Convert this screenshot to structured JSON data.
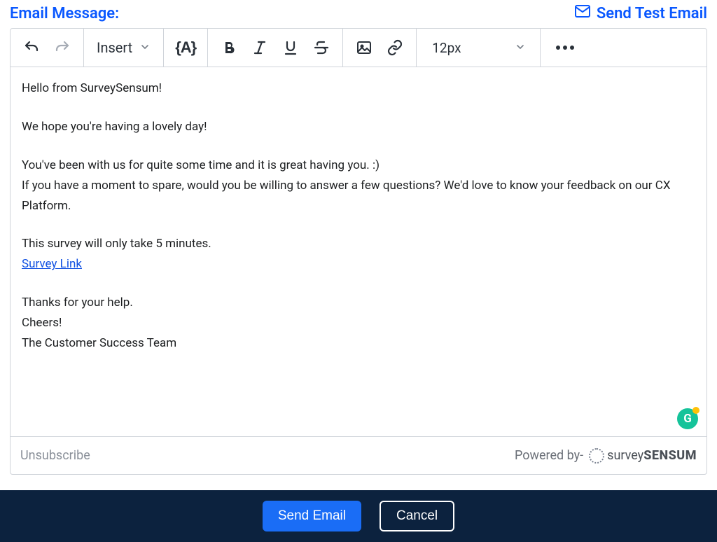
{
  "header": {
    "title": "Email Message:",
    "send_test": "Send Test Email"
  },
  "toolbar": {
    "insert_label": "Insert",
    "vars_label": "{A}",
    "fontsize": "12px"
  },
  "body": {
    "p1": "Hello from SurveySensum!",
    "p2": "We hope you're having a lovely day!",
    "p3": "You've been with us for quite some time and it is great having you. :)",
    "p4": "If you have a moment to spare, would you be willing to answer a few questions? We'd love to know your feedback on our CX Platform.",
    "p5": "This survey will only take 5 minutes.",
    "link_text": "Survey Link",
    "p6": "Thanks for your help.",
    "p7": "Cheers!",
    "p8": "The Customer Success Team"
  },
  "footer": {
    "unsubscribe": "Unsubscribe",
    "powered_by": "Powered by-",
    "brand_light": "survey",
    "brand_bold": "SENSUM"
  },
  "actions": {
    "send": "Send Email",
    "cancel": "Cancel"
  },
  "grammarly_letter": "G"
}
